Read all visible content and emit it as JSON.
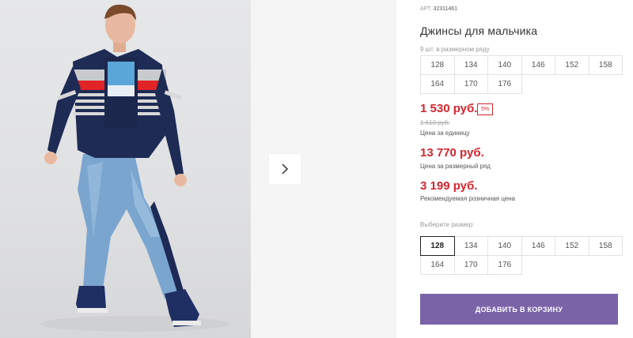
{
  "product": {
    "art_label": "АРТ.",
    "art_value": "32311461",
    "title": "Джинсы для мальчика",
    "pack_note": "9 шт. в размерном ряду",
    "pack_sizes": [
      "128",
      "134",
      "140",
      "146",
      "152",
      "158",
      "164",
      "170",
      "176"
    ]
  },
  "pricing": {
    "unit_price": "1 530 руб.",
    "discount": "5%",
    "old_price": "1 610 руб.",
    "unit_label": "Цена за единицу",
    "pack_price": "13 770 руб.",
    "pack_label": "Цена за размерный ряд",
    "retail_price": "3 199 руб.",
    "retail_label": "Рекомендуемая розничная цена"
  },
  "size_picker": {
    "label": "Выберите размер:",
    "sizes": [
      "128",
      "134",
      "140",
      "146",
      "152",
      "158",
      "164",
      "170",
      "176"
    ],
    "selected": "128"
  },
  "cart": {
    "add_label": "ДОБАВИТЬ В КОРЗИНУ"
  },
  "gallery": {
    "next_icon": "chevron-right-icon",
    "photo_subject": "boy-in-jeans-photo"
  },
  "colors": {
    "price_red": "#d6262f",
    "button_purple": "#7b63a8"
  }
}
